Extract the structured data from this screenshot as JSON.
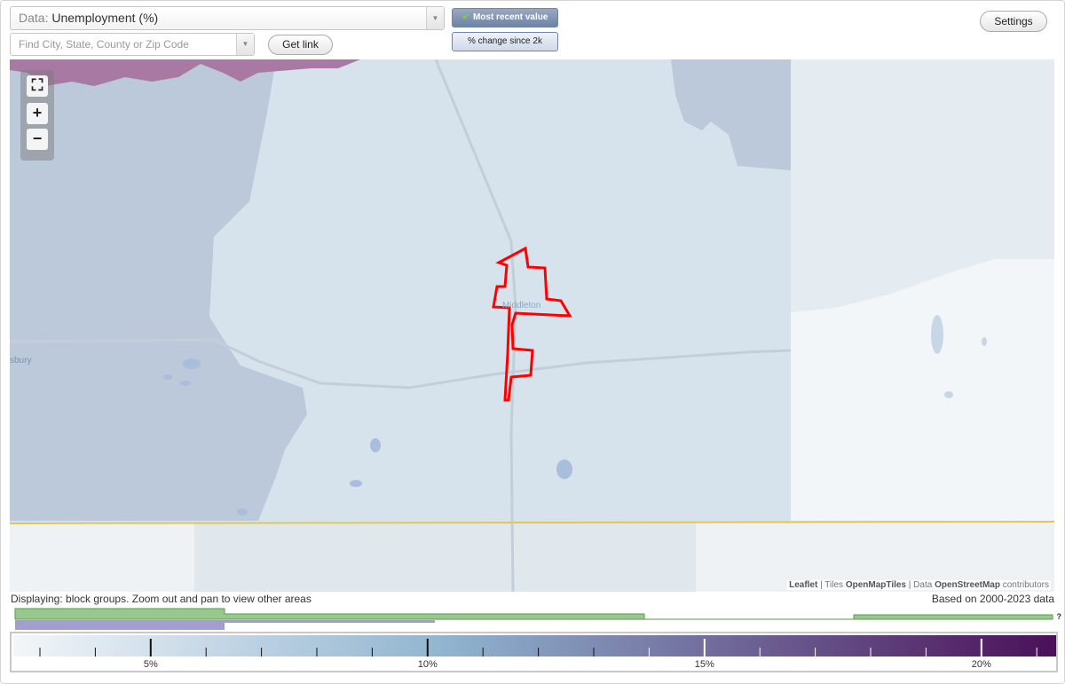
{
  "data_select": {
    "prefix": "Data:",
    "value": "Unemployment (%)"
  },
  "search": {
    "placeholder": "Find City, State, County or Zip Code"
  },
  "buttons": {
    "get_link": "Get link",
    "most_recent": "Most recent value",
    "pct_change": "% change since 2k",
    "settings": "Settings"
  },
  "map": {
    "town_label": "Middleton",
    "edge_label": "sbury",
    "highlight_color": "#ff0000",
    "attribution": {
      "leaflet": "Leaflet",
      "sep1": " | Tiles ",
      "tiles": "OpenMapTiles",
      "sep2": " | Data ",
      "osm": "OpenStreetMap",
      "contributors": " contributors"
    }
  },
  "footer": {
    "displaying": "Displaying: block groups. Zoom out and pan to view other areas",
    "based_on": "Based on 2000-2023 data",
    "histogram_help": "?"
  },
  "legend": {
    "labels": [
      "5%",
      "10%",
      "15%",
      "20%"
    ],
    "color_start": "#f2f6f9",
    "color_mid": "#8fb3cf",
    "color_end": "#4a0f58"
  }
}
